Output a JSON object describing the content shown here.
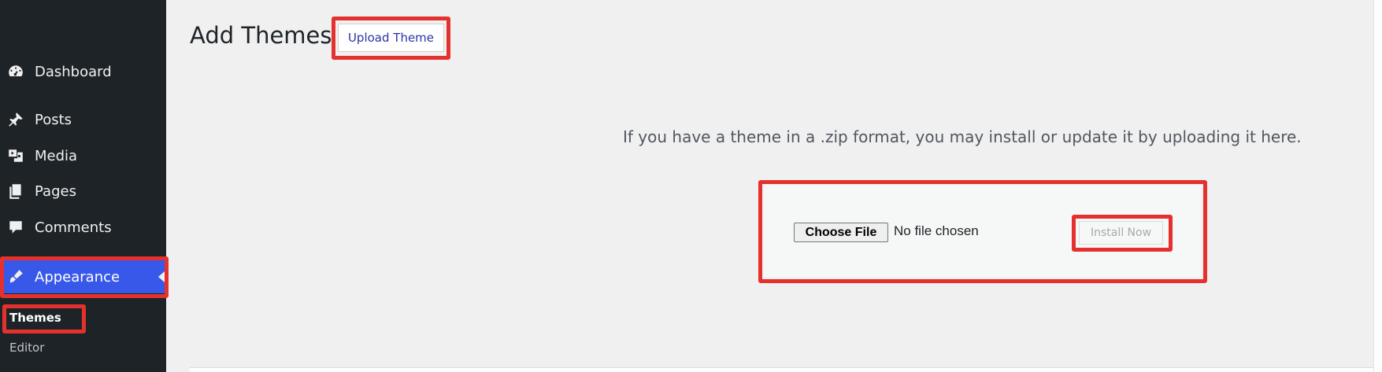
{
  "sidebar": {
    "items": [
      {
        "label": "Dashboard",
        "icon": "dashboard-icon"
      },
      {
        "label": "Posts",
        "icon": "pin-icon"
      },
      {
        "label": "Media",
        "icon": "media-icon"
      },
      {
        "label": "Pages",
        "icon": "pages-icon"
      },
      {
        "label": "Comments",
        "icon": "comment-icon"
      },
      {
        "label": "Appearance",
        "icon": "brush-icon",
        "active": true
      }
    ],
    "submenu": [
      {
        "label": "Themes",
        "current": true
      },
      {
        "label": "Editor"
      }
    ]
  },
  "main": {
    "title": "Add Themes",
    "upload_button": "Upload Theme",
    "help_text": "If you have a theme in a .zip format, you may install or update it by uploading it here.",
    "file_input": {
      "button_label": "Choose File",
      "status": "No file chosen"
    },
    "install_button": "Install Now"
  },
  "colors": {
    "sidebar_bg": "#1d2327",
    "active_bg": "#3858e9",
    "highlight": "#e5312d",
    "page_bg": "#f0f0f1"
  }
}
